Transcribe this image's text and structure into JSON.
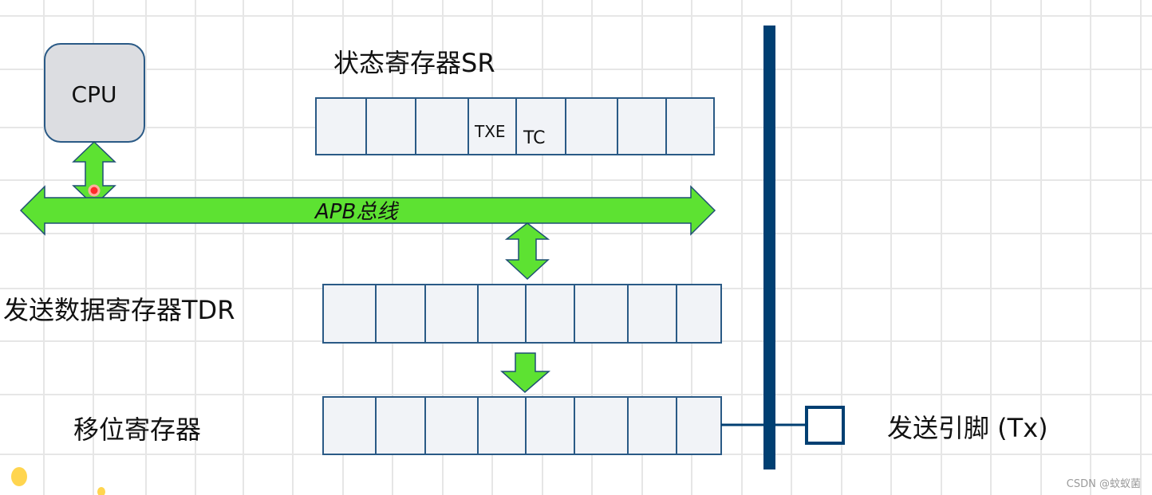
{
  "cpu": {
    "label": "CPU"
  },
  "status_register": {
    "title": "状态寄存器SR",
    "bits": [
      "",
      "",
      "",
      "TXE",
      "TC",
      "",
      "",
      ""
    ]
  },
  "bus": {
    "label": "APB总线"
  },
  "tdr": {
    "title": "发送数据寄存器TDR"
  },
  "shift_register": {
    "title": "移位寄存器"
  },
  "tx_pin": {
    "label": "发送引脚 (Tx)"
  },
  "watermark": "CSDN @蚊蚁菌",
  "colors": {
    "arrow": "#5de232",
    "bus_line": "#003f72",
    "cell_border": "#2a5a86",
    "grid": "#e6e6e6"
  }
}
